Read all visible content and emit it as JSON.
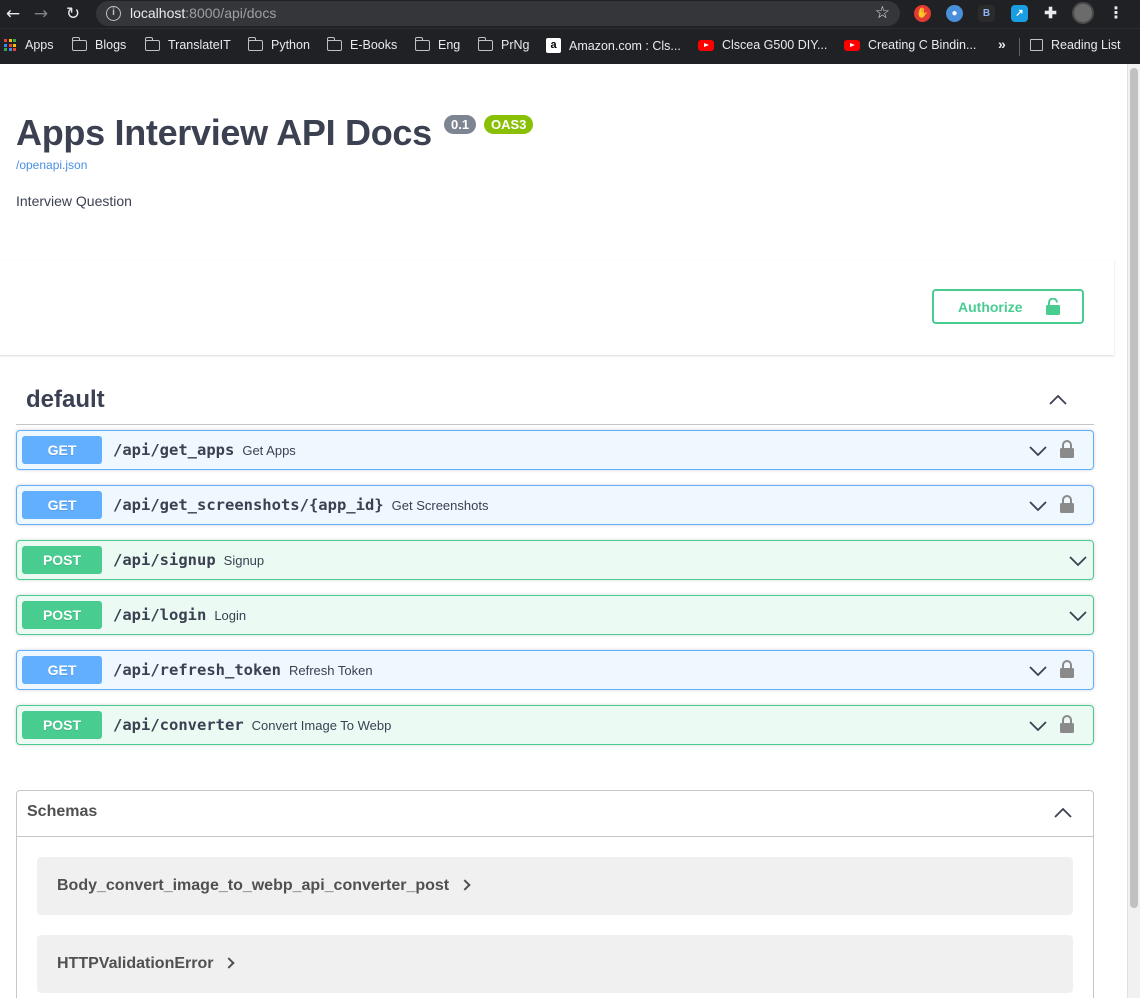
{
  "browser": {
    "url_host": "localhost",
    "url_rest": ":8000/api/docs",
    "bookmarks": [
      "Apps",
      "Blogs",
      "TranslateIT",
      "Python",
      "E-Books",
      "Eng",
      "PrNg",
      "Amazon.com : Cls...",
      "Clscea G500 DIY...",
      "Creating C Bindin..."
    ],
    "more": "»",
    "reading_list": "Reading List"
  },
  "info": {
    "title": "Apps Interview API Docs",
    "version": "0.1",
    "oas": "OAS3",
    "spec_link": "/openapi.json",
    "description": "Interview Question"
  },
  "auth": {
    "label": "Authorize"
  },
  "tag": {
    "name": "default"
  },
  "operations": [
    {
      "method": "GET",
      "path": "/api/get_apps",
      "summary": "Get Apps",
      "locked": true
    },
    {
      "method": "GET",
      "path": "/api/get_screenshots/{app_id}",
      "summary": "Get Screenshots",
      "locked": true
    },
    {
      "method": "POST",
      "path": "/api/signup",
      "summary": "Signup",
      "locked": false
    },
    {
      "method": "POST",
      "path": "/api/login",
      "summary": "Login",
      "locked": false
    },
    {
      "method": "GET",
      "path": "/api/refresh_token",
      "summary": "Refresh Token",
      "locked": true
    },
    {
      "method": "POST",
      "path": "/api/converter",
      "summary": "Convert Image To Webp",
      "locked": true
    }
  ],
  "schemas": {
    "title": "Schemas",
    "items": [
      "Body_convert_image_to_webp_api_converter_post",
      "HTTPValidationError"
    ]
  },
  "colors": {
    "get": "#61affe",
    "post": "#49cc90",
    "text": "#3b4151"
  }
}
